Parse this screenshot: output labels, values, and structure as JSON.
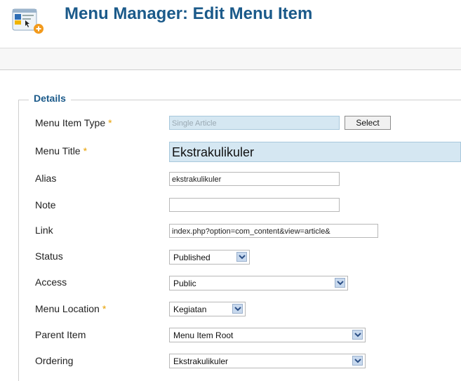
{
  "header": {
    "title": "Menu Manager: Edit Menu Item",
    "icon": "menu-manager-icon"
  },
  "details": {
    "legend": "Details",
    "fields": {
      "menu_item_type": {
        "label": "Menu Item Type",
        "required": "*",
        "value": "Single Article",
        "button": "Select"
      },
      "menu_title": {
        "label": "Menu Title",
        "required": "*",
        "value": "Ekstrakulikuler"
      },
      "alias": {
        "label": "Alias",
        "value": "ekstrakulikuler"
      },
      "note": {
        "label": "Note",
        "value": ""
      },
      "link": {
        "label": "Link",
        "value": "index.php?option=com_content&view=article&"
      },
      "status": {
        "label": "Status",
        "value": "Published"
      },
      "access": {
        "label": "Access",
        "value": "Public"
      },
      "menu_location": {
        "label": "Menu Location",
        "required": "*",
        "value": "Kegiatan"
      },
      "parent_item": {
        "label": "Parent Item",
        "value": "Menu Item Root"
      },
      "ordering": {
        "label": "Ordering",
        "value": "Ekstrakulikuler"
      }
    }
  },
  "colors": {
    "title": "#1b5a8a",
    "required": "#e8a000",
    "readonly_field": "#d5e7f2"
  }
}
